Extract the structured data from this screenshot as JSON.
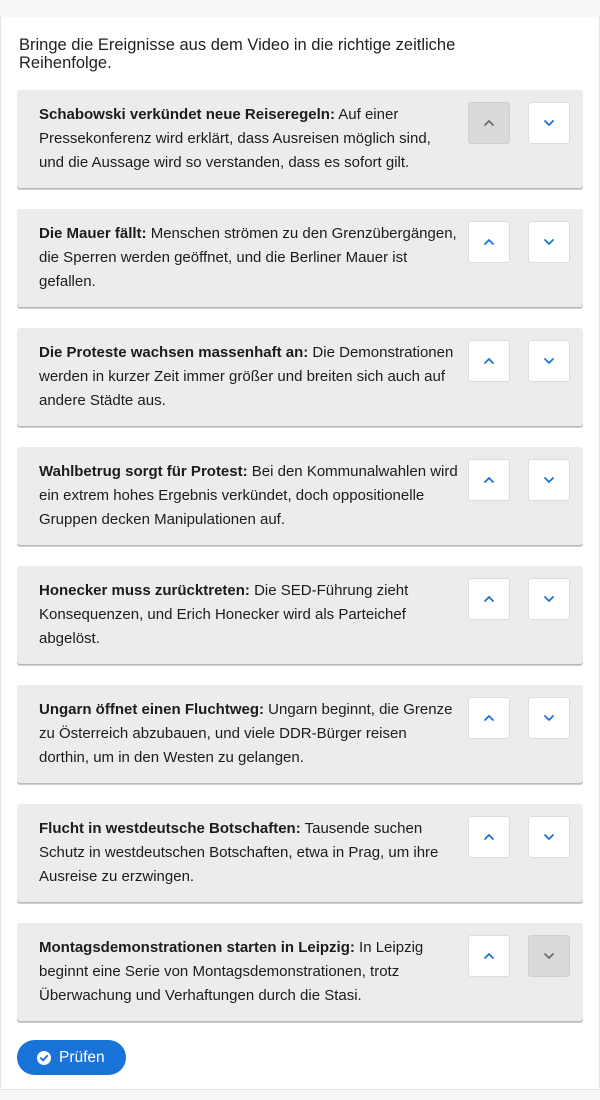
{
  "instruction": "Bringe die Ereignisse aus dem Video in die richtige zeitliche Reihenfolge.",
  "items": [
    {
      "title": "Schabowski verkündet neue Reiseregeln:",
      "text": " Auf einer Pressekonferenz wird erklärt, dass Ausreisen möglich sind, und die Aussage wird so verstanden, dass es sofort gilt.",
      "up_enabled": false,
      "down_enabled": true
    },
    {
      "title": "Die Mauer fällt:",
      "text": " Menschen strömen zu den Grenzübergängen, die Sperren werden geöffnet, und die Berliner Mauer ist gefallen.",
      "up_enabled": true,
      "down_enabled": true
    },
    {
      "title": "Die Proteste wachsen massenhaft an:",
      "text": " Die Demonstrationen werden in kurzer Zeit immer größer und breiten sich auch auf andere Städte aus.",
      "up_enabled": true,
      "down_enabled": true
    },
    {
      "title": "Wahlbetrug sorgt für Protest:",
      "text": " Bei den Kommunalwahlen wird ein extrem hohes Ergebnis verkündet, doch oppositionelle Gruppen decken Manipulationen auf.",
      "up_enabled": true,
      "down_enabled": true
    },
    {
      "title": "Honecker muss zurücktreten:",
      "text": " Die SED-Führung zieht Konsequenzen, und Erich Honecker wird als Parteichef abgelöst.",
      "up_enabled": true,
      "down_enabled": true
    },
    {
      "title": "Ungarn öffnet einen Fluchtweg:",
      "text": " Ungarn beginnt, die Grenze zu Österreich abzubauen, und viele DDR-Bürger reisen dorthin, um in den Westen zu gelangen.",
      "up_enabled": true,
      "down_enabled": true
    },
    {
      "title": "Flucht in westdeutsche Botschaften:",
      "text": " Tausende suchen Schutz in westdeutschen Botschaften, etwa in Prag, um ihre Ausreise zu erzwingen.",
      "up_enabled": true,
      "down_enabled": true
    },
    {
      "title": "Montagsdemonstrationen starten in Leipzig:",
      "text": " In Leipzig beginnt eine Serie von Montagsdemonstrationen, trotz Überwachung und Verhaftungen durch die Stasi.",
      "up_enabled": true,
      "down_enabled": false
    }
  ],
  "check_button": {
    "label": "Prüfen",
    "icon": "check-circle-icon"
  },
  "colors": {
    "accent": "#1a73d9",
    "item_bg": "#ececec",
    "disabled_btn": "#dadada"
  },
  "icons": {
    "up": "chevron-up-icon",
    "down": "chevron-down-icon"
  }
}
